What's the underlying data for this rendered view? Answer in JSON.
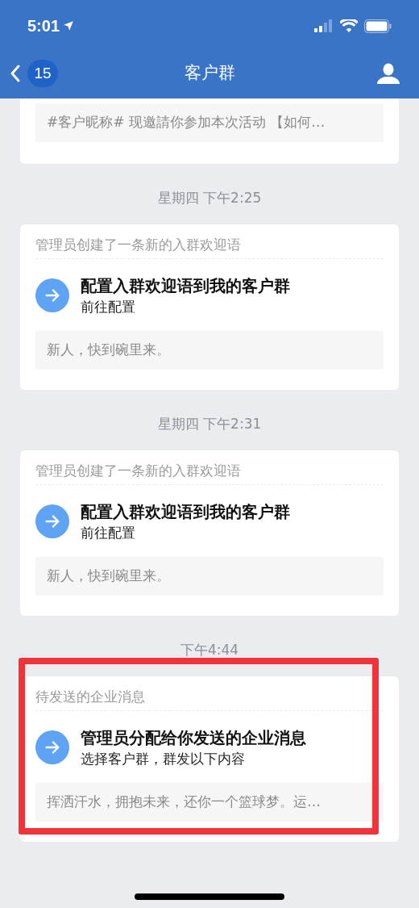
{
  "status_bar": {
    "time": "5:01"
  },
  "nav": {
    "back_badge": "15",
    "title": "客户群"
  },
  "messages": [
    {
      "kind": "partial",
      "preview": "#客户昵称# 现邀請你参加本次活动 【如何…"
    },
    {
      "kind": "card",
      "timestamp": "星期四 下午2:25",
      "header": "管理员创建了一条新的入群欢迎语",
      "title": "配置入群欢迎语到我的客户群",
      "subtitle": "前往配置",
      "preview": "新人，快到碗里来。",
      "highlighted": false
    },
    {
      "kind": "card",
      "timestamp": "星期四 下午2:31",
      "header": "管理员创建了一条新的入群欢迎语",
      "title": "配置入群欢迎语到我的客户群",
      "subtitle": "前往配置",
      "preview": "新人，快到碗里来。",
      "highlighted": false
    },
    {
      "kind": "card",
      "timestamp": "下午4:44",
      "header": "待发送的企业消息",
      "title": "管理员分配给你发送的企业消息",
      "subtitle": "选择客户群，群发以下内容",
      "preview": "挥洒汗水，拥抱未来，还你一个篮球梦。运…",
      "highlighted": true
    }
  ]
}
